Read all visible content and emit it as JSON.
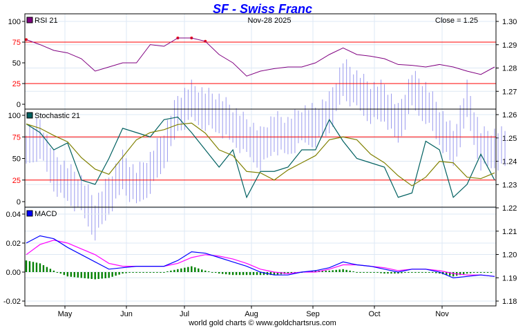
{
  "chart_data": {
    "type": "line",
    "title": "SF  -  Swiss Franc",
    "date": "Nov-28  2025",
    "close_label": "Close = 1.25",
    "footer": "world gold charts © www.goldchartsrus.com",
    "months": [
      "May",
      "Jun",
      "Jul",
      "Aug",
      "Sep",
      "Oct",
      "Nov"
    ],
    "price_axis": {
      "ticks": [
        "1.30",
        "1.29",
        "1.28",
        "1.27",
        "1.26",
        "1.25",
        "1.24",
        "1.23",
        "1.22",
        "1.21",
        "1.20",
        "1.19",
        "1.18"
      ],
      "ylim": [
        1.18,
        1.3
      ]
    },
    "price_close": [
      1.245,
      1.25,
      1.235,
      1.23,
      1.225,
      1.215,
      1.225,
      1.235,
      1.228,
      1.235,
      1.245,
      1.26,
      1.265,
      1.262,
      1.26,
      1.255,
      1.25,
      1.245,
      1.252,
      1.25,
      1.255,
      1.255,
      1.26,
      1.275,
      1.27,
      1.265,
      1.265,
      1.255,
      1.27,
      1.265,
      1.255,
      1.245,
      1.265,
      1.245,
      1.245
    ],
    "panels": {
      "rsi": {
        "label": "RSI 21",
        "ticks": [
          "100",
          "75",
          "50",
          "25",
          "0"
        ],
        "levels": [
          75,
          25
        ],
        "values": [
          78,
          72,
          65,
          62,
          55,
          40,
          45,
          50,
          50,
          72,
          70,
          80,
          80,
          76,
          60,
          50,
          34,
          40,
          43,
          45,
          45,
          50,
          60,
          68,
          60,
          58,
          55,
          48,
          47,
          45,
          48,
          45,
          40,
          36,
          45
        ]
      },
      "stochastic": {
        "label": "Stochastic 21",
        "ticks": [
          "100",
          "75",
          "50",
          "25",
          "0"
        ],
        "levels": [
          75,
          25
        ],
        "values": [
          90,
          80,
          60,
          68,
          25,
          20,
          50,
          85,
          80,
          75,
          95,
          98,
          80,
          60,
          40,
          60,
          5,
          35,
          35,
          40,
          60,
          60,
          95,
          70,
          50,
          45,
          40,
          5,
          10,
          70,
          60,
          5,
          20,
          55,
          25
        ]
      },
      "macd": {
        "label": "MACD",
        "ticks": [
          "0.04",
          "0.02",
          "0.00",
          "-0.02"
        ],
        "ylim": [
          -0.02,
          0.04
        ],
        "macd": [
          0.02,
          0.025,
          0.023,
          0.017,
          0.012,
          0.007,
          0.002,
          0.003,
          0.004,
          0.004,
          0.004,
          0.008,
          0.014,
          0.013,
          0.01,
          0.007,
          0.004,
          0.0,
          -0.002,
          -0.002,
          0.0,
          0.001,
          0.003,
          0.007,
          0.005,
          0.004,
          0.002,
          0.0,
          0.002,
          0.002,
          0.0,
          -0.004,
          -0.003,
          -0.002,
          -0.003
        ],
        "signal": [
          0.012,
          0.019,
          0.022,
          0.02,
          0.016,
          0.012,
          0.006,
          0.004,
          0.004,
          0.004,
          0.004,
          0.006,
          0.01,
          0.012,
          0.011,
          0.009,
          0.006,
          0.002,
          0.0,
          -0.001,
          0.0,
          0.0,
          0.002,
          0.005,
          0.005,
          0.004,
          0.003,
          0.001,
          0.002,
          0.002,
          0.001,
          -0.001,
          -0.002,
          -0.002,
          -0.003
        ]
      }
    },
    "colors": {
      "rsi": "#800080",
      "rsi_fill": "#ff0000",
      "stoch_fast": "#006060",
      "stoch_slow": "#808000",
      "macd": "#0000ff",
      "signal": "#ff00ff",
      "hist": "#008000",
      "bars": "#9999ee",
      "level": "#ff0000",
      "grid": "#dde8f4"
    }
  }
}
